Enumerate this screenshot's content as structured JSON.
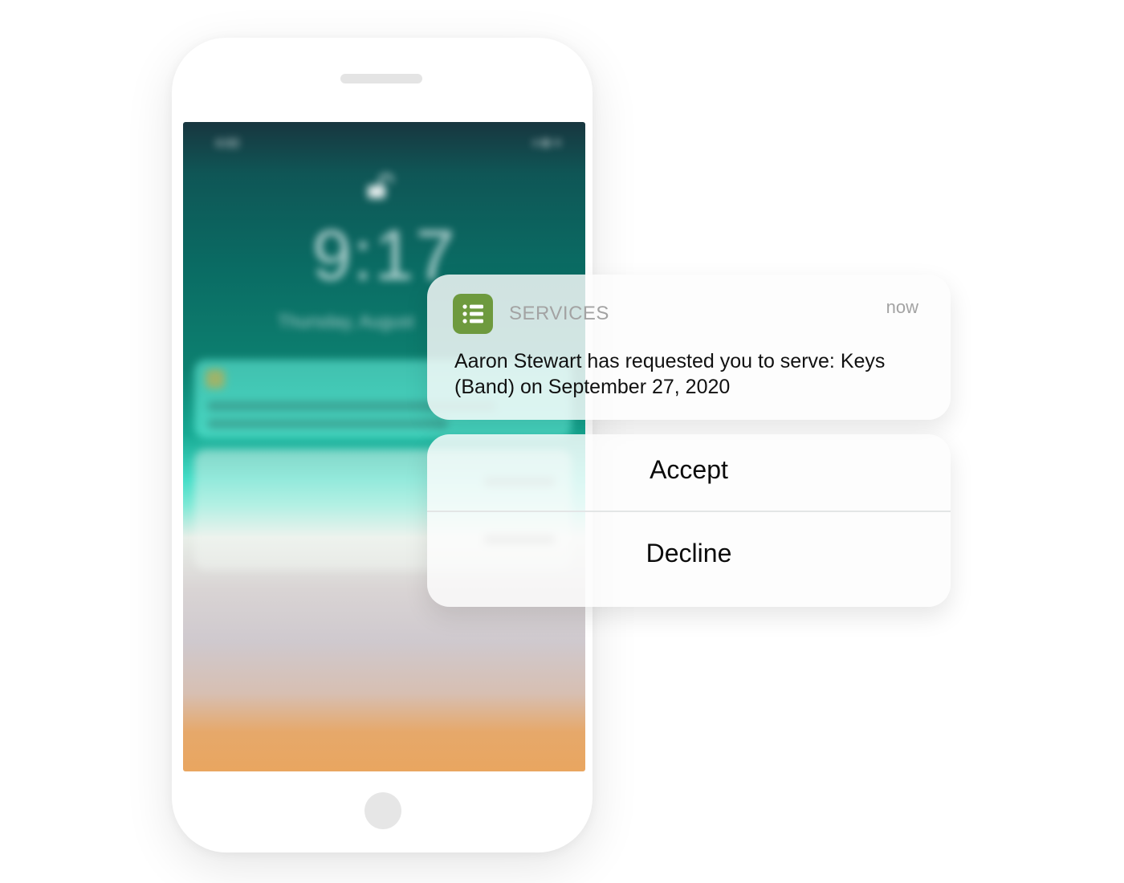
{
  "lockscreen": {
    "time": "9:17",
    "date": "Thursday, August",
    "status_left": "4:02",
    "status_right": "◂ ◆ ●"
  },
  "notification": {
    "app_name": "SERVICES",
    "time": "now",
    "message": "Aaron Stewart has requested you to serve: Keys (Band) on September 27, 2020",
    "icon": "list-icon",
    "icon_color": "#6e9a3e"
  },
  "actions": {
    "accept_label": "Accept",
    "decline_label": "Decline"
  }
}
